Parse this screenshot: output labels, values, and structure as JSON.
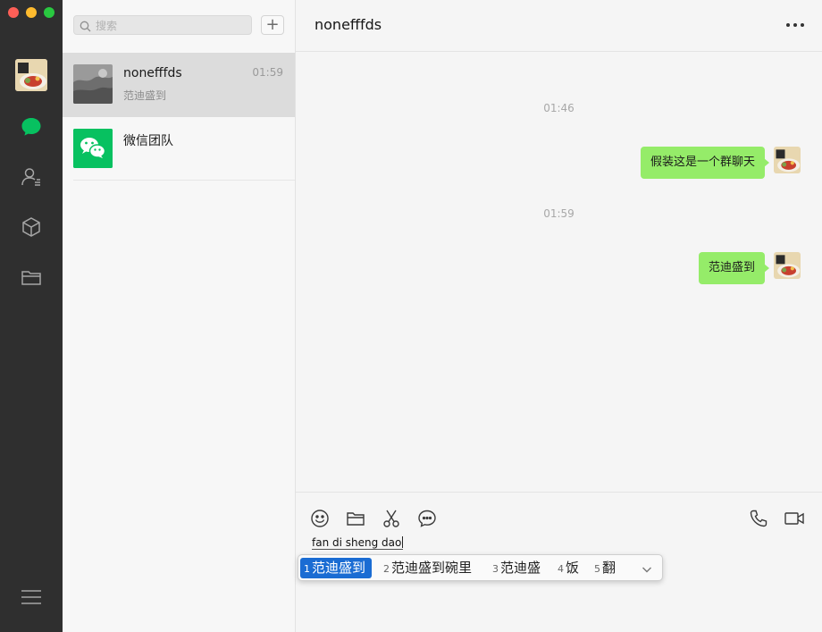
{
  "sidebar": {
    "icons": [
      "chat-icon",
      "contacts-icon",
      "favorites-icon",
      "files-icon",
      "menu-icon"
    ],
    "accent": "#07c160"
  },
  "search": {
    "placeholder": "搜索"
  },
  "add_button": {
    "label": "+"
  },
  "conversations": [
    {
      "name": "nonefffds",
      "preview": "范迪盛到",
      "time": "01:59",
      "active": true
    },
    {
      "name": "微信团队",
      "preview": "",
      "time": "",
      "active": false
    }
  ],
  "chat": {
    "title": "nonefffds",
    "more_label": "•••",
    "messages": [
      {
        "timestamp": "01:46",
        "text": "假装这是一个群聊天"
      },
      {
        "timestamp": "01:59",
        "text": "范迪盛到"
      }
    ],
    "bubble_color": "#95ec69"
  },
  "input": {
    "text": "fan di sheng dao",
    "toolbar": [
      "emoji-icon",
      "folder-icon",
      "scissors-icon",
      "chat-bubble-icon",
      "phone-icon",
      "video-icon"
    ]
  },
  "ime": {
    "candidates": [
      {
        "num": "1",
        "text": "范迪盛到"
      },
      {
        "num": "2",
        "text": "范迪盛到碗里"
      },
      {
        "num": "3",
        "text": "范迪盛"
      },
      {
        "num": "4",
        "text": "饭"
      },
      {
        "num": "5",
        "text": "翻"
      }
    ],
    "selected_color": "#1a6cd3"
  }
}
